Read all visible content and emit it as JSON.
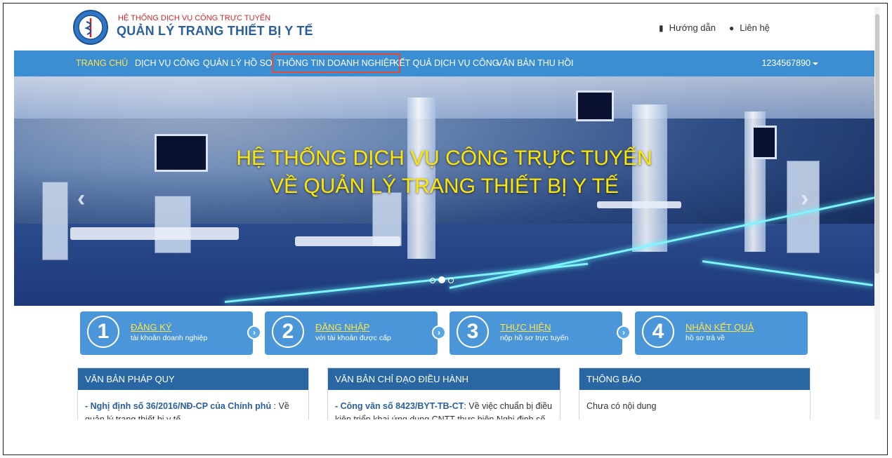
{
  "header": {
    "brand_top": "HỆ THỐNG DỊCH VỤ CÔNG TRỰC TUYẾN",
    "brand_main": "QUẢN LÝ TRANG THIẾT BỊ Y TẾ",
    "help_label": "Hướng dẫn",
    "contact_label": "Liên hệ",
    "help_icon": "book-icon",
    "contact_icon": "map-marker-icon"
  },
  "nav": {
    "items": [
      {
        "label": "TRANG CHỦ",
        "active": true
      },
      {
        "label": "DỊCH VỤ CÔNG",
        "active": false
      },
      {
        "label": "QUẢN LÝ HỒ SƠ",
        "active": false
      },
      {
        "label": "THÔNG TIN DOANH NGHIỆP",
        "active": false,
        "highlighted": true
      },
      {
        "label": "KẾT QUẢ DỊCH VỤ CÔNG",
        "active": false
      },
      {
        "label": "VĂN BẢN THU HỒI",
        "active": false
      }
    ],
    "user": "1234567890"
  },
  "banner": {
    "line1": "HỆ THỐNG DỊCH VỤ CÔNG TRỰC TUYẾN",
    "line2": "VỀ QUẢN LÝ TRANG THIẾT BỊ Y TẾ",
    "prev": "‹",
    "next": "›",
    "slides": 3,
    "current_slide": 2
  },
  "steps": [
    {
      "num": "1",
      "title": "ĐĂNG KÝ",
      "sub": "tài khoản doanh nghiệp"
    },
    {
      "num": "2",
      "title": "ĐĂNG NHẬP",
      "sub": "với tài khoản được cấp"
    },
    {
      "num": "3",
      "title": "THỰC HIỆN",
      "sub": "nộp hồ sơ trực tuyến"
    },
    {
      "num": "4",
      "title": "NHẬN KẾT QUẢ",
      "sub": "hồ sơ trả về"
    }
  ],
  "panels": {
    "legal": {
      "title": "VĂN BẢN PHÁP QUY",
      "link": "- Nghị định số 36/2016/NĐ-CP của Chính phủ",
      "text": " : Về quản lý trang thiết bị y tế"
    },
    "directive": {
      "title": "VĂN BẢN CHỈ ĐẠO ĐIỀU HÀNH",
      "link": "- Công văn số 8423/BYT-TB-CT",
      "text": ": Về việc chuẩn bị điều kiện triển khai ứng dụng CNTT thực hiện Nghị định số"
    },
    "notice": {
      "title": "THÔNG BÁO",
      "text": "Chưa có nội dung"
    }
  },
  "colors": {
    "nav_bg": "#3b8ed1",
    "active_nav": "#ffe24a",
    "brand_blue": "#2a5f9f",
    "brand_red": "#d6262b",
    "banner_title": "#ffe600",
    "panel_header": "#2867a4",
    "step_bg": "#4a96d8",
    "highlight_box": "#e24a3b"
  }
}
